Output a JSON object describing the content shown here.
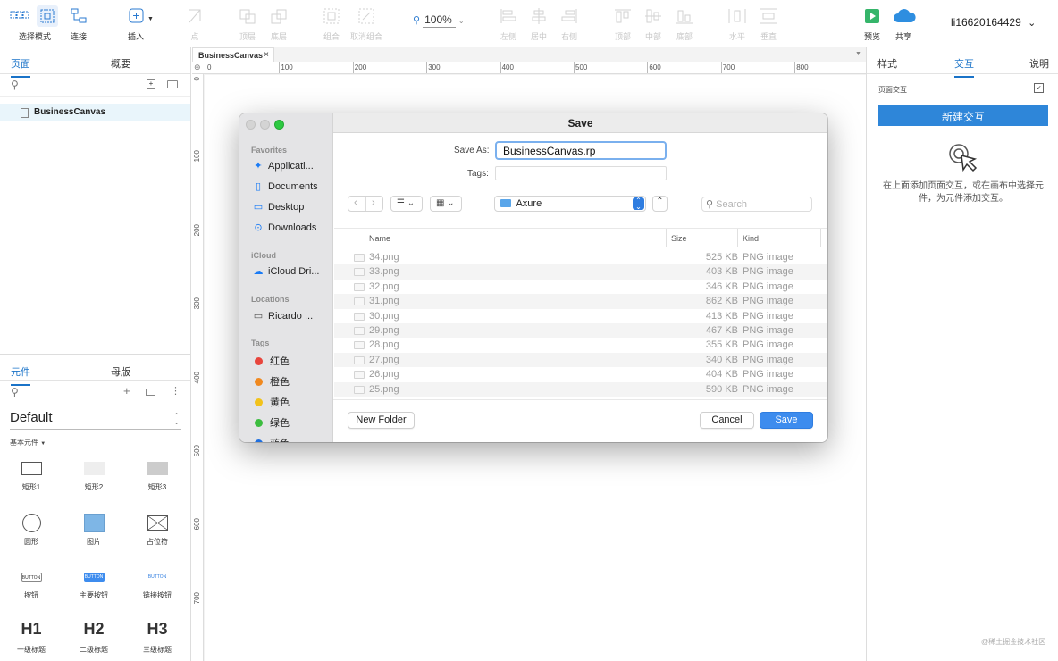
{
  "toolbar": {
    "select_mode": "选择模式",
    "connect": "连接",
    "insert": "插入",
    "point": "点",
    "top_layer": "顶层",
    "bottom_layer": "底层",
    "group": "组合",
    "ungroup": "取消组合",
    "zoom": "100%",
    "align_left": "左侧",
    "align_center": "居中",
    "align_right": "右侧",
    "align_top": "顶部",
    "align_middle": "中部",
    "align_bottom": "底部",
    "distribute_h": "水平",
    "distribute_v": "垂直",
    "preview": "预览",
    "share": "共享",
    "username": "li16620164429"
  },
  "left_panel": {
    "tab_pages": "页面",
    "tab_outline": "概要",
    "page_item": "BusinessCanvas",
    "tab_widgets": "元件",
    "tab_masters": "母版",
    "library": "Default",
    "section": "基本元件",
    "widgets": [
      {
        "label": "矩形1"
      },
      {
        "label": "矩形2"
      },
      {
        "label": "矩形3"
      },
      {
        "label": "圆形"
      },
      {
        "label": "图片"
      },
      {
        "label": "占位符"
      },
      {
        "label": "按钮",
        "inner": "BUTTON"
      },
      {
        "label": "主要按钮",
        "inner": "BUTTON"
      },
      {
        "label": "链接按钮",
        "inner": "BUTTON"
      },
      {
        "label": "一级标题",
        "inner": "H1"
      },
      {
        "label": "二级标题",
        "inner": "H2"
      },
      {
        "label": "三级标题",
        "inner": "H3"
      }
    ]
  },
  "canvas": {
    "doc_tab": "BusinessCanvas",
    "h_ticks": [
      "0",
      "100",
      "200",
      "300",
      "400",
      "500",
      "600",
      "700",
      "800"
    ],
    "v_ticks": [
      "0",
      "100",
      "200",
      "300",
      "400",
      "500",
      "600",
      "700"
    ]
  },
  "right_panel": {
    "tab_style": "样式",
    "tab_interaction": "交互",
    "tab_notes": "说明",
    "page_interaction": "页面交互",
    "new_interaction": "新建交互",
    "hint": "在上面添加页面交互，或在画布中选择元件，为元件添加交互。"
  },
  "dialog": {
    "title": "Save",
    "save_as_label": "Save As:",
    "save_as_value": "BusinessCanvas.rp",
    "tags_label": "Tags:",
    "location": "Axure",
    "search_placeholder": "Search",
    "favorites_heading": "Favorites",
    "favorites": [
      {
        "label": "Applicati...",
        "icon": "applications-icon"
      },
      {
        "label": "Documents",
        "icon": "document-icon"
      },
      {
        "label": "Desktop",
        "icon": "desktop-icon"
      },
      {
        "label": "Downloads",
        "icon": "download-icon"
      }
    ],
    "icloud_heading": "iCloud",
    "icloud_item": "iCloud Dri...",
    "locations_heading": "Locations",
    "location_item": "Ricardo ...",
    "tags_heading": "Tags",
    "tags": [
      {
        "label": "红色",
        "color": "#e8453c"
      },
      {
        "label": "橙色",
        "color": "#f0891f"
      },
      {
        "label": "黄色",
        "color": "#f2c21b"
      },
      {
        "label": "绿色",
        "color": "#3cbd3f"
      },
      {
        "label": "蓝色",
        "color": "#1e6fe0"
      }
    ],
    "columns": {
      "name": "Name",
      "size": "Size",
      "kind": "Kind"
    },
    "files": [
      {
        "name": "34.png",
        "size": "525 KB",
        "kind": "PNG image"
      },
      {
        "name": "33.png",
        "size": "403 KB",
        "kind": "PNG image"
      },
      {
        "name": "32.png",
        "size": "346 KB",
        "kind": "PNG image"
      },
      {
        "name": "31.png",
        "size": "862 KB",
        "kind": "PNG image"
      },
      {
        "name": "30.png",
        "size": "413 KB",
        "kind": "PNG image"
      },
      {
        "name": "29.png",
        "size": "467 KB",
        "kind": "PNG image"
      },
      {
        "name": "28.png",
        "size": "355 KB",
        "kind": "PNG image"
      },
      {
        "name": "27.png",
        "size": "340 KB",
        "kind": "PNG image"
      },
      {
        "name": "26.png",
        "size": "404 KB",
        "kind": "PNG image"
      },
      {
        "name": "25.png",
        "size": "590 KB",
        "kind": "PNG image"
      }
    ],
    "new_folder": "New Folder",
    "cancel": "Cancel",
    "save": "Save"
  },
  "watermark": "@稀土掘金技术社区",
  "colors": {
    "accent": "#1a73c8",
    "primary_button": "#2e86d9"
  }
}
